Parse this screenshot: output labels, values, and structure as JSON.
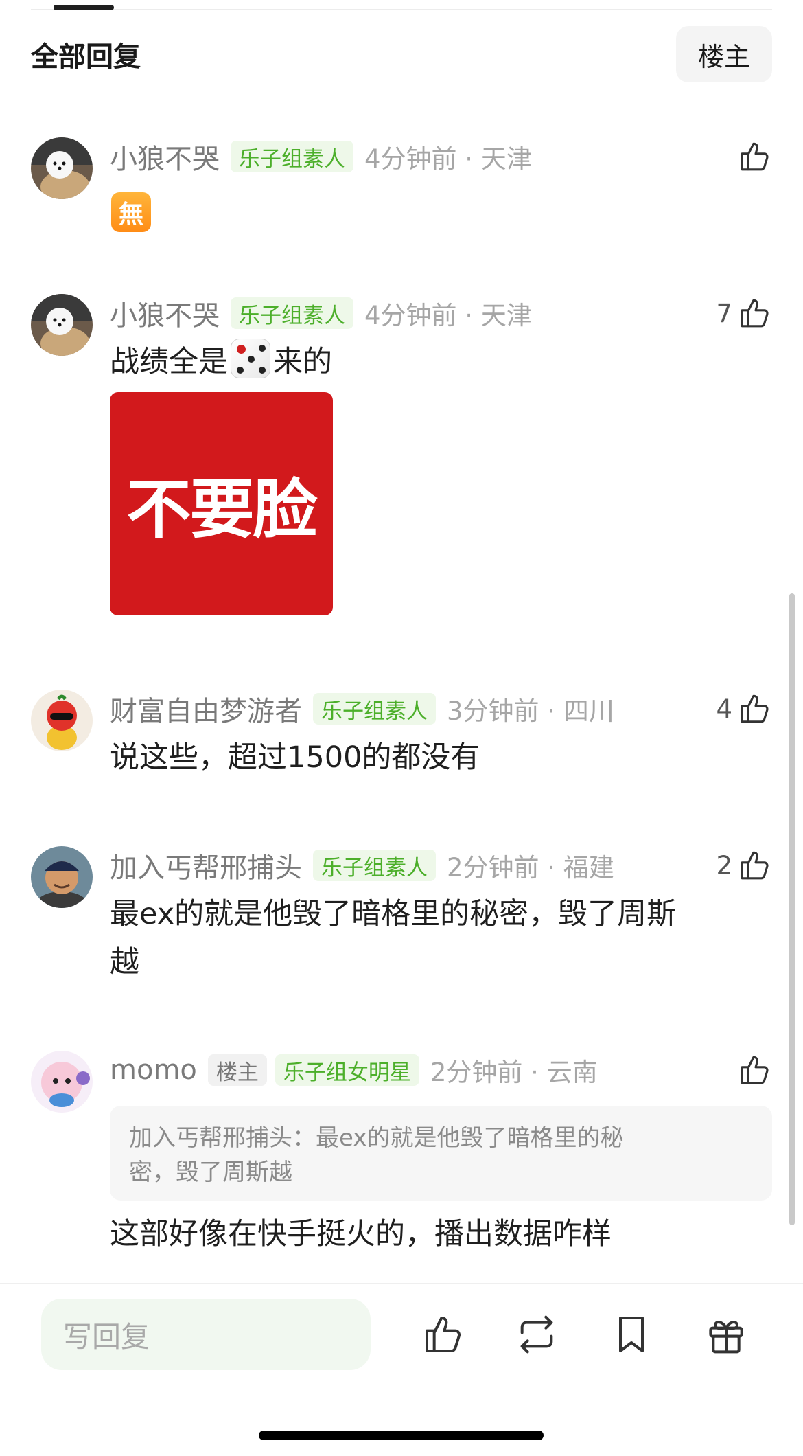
{
  "header": {
    "title": "全部回复",
    "owner_filter": "楼主"
  },
  "comments": [
    {
      "username": "小狼不哭",
      "badge": "乐子组素人",
      "time_location": "4分钟前 · 天津",
      "like_count": "",
      "emoji_char": "無"
    },
    {
      "username": "小狼不哭",
      "badge": "乐子组素人",
      "time_location": "4分钟前 · 天津",
      "like_count": "7",
      "text_before_emoji": "战绩全是",
      "text_after_emoji": "来的",
      "sticker_text": "不要脸"
    },
    {
      "username": "财富自由梦游者",
      "badge": "乐子组素人",
      "time_location": "3分钟前 · 四川",
      "like_count": "4",
      "text": "说这些，超过1500的都没有"
    },
    {
      "username": "加入丐帮邢捕头",
      "badge": "乐子组素人",
      "time_location": "2分钟前 · 福建",
      "like_count": "2",
      "text_line1": "最ex的就是他毁了暗格里的秘密，毁了周斯",
      "text_line2": "越"
    },
    {
      "username": "momo",
      "owner_badge": "楼主",
      "badge": "乐子组女明星",
      "time_location": "2分钟前 · 云南",
      "like_count": "",
      "quote_line1": "加入丐帮邢捕头：最ex的就是他毁了暗格里的秘",
      "quote_line2": "密，毁了周斯越",
      "text": "这部好像在快手挺火的，播出数据咋样"
    }
  ],
  "bottom_bar": {
    "reply_placeholder": "写回复",
    "icons": [
      "like-icon",
      "repost-icon",
      "bookmark-icon",
      "gift-icon"
    ]
  },
  "colors": {
    "badge_green": "#4caf2a",
    "badge_green_bg": "#eef8e9",
    "sticker_red": "#d2191c",
    "reply_input_bg": "#f1f8f0"
  }
}
